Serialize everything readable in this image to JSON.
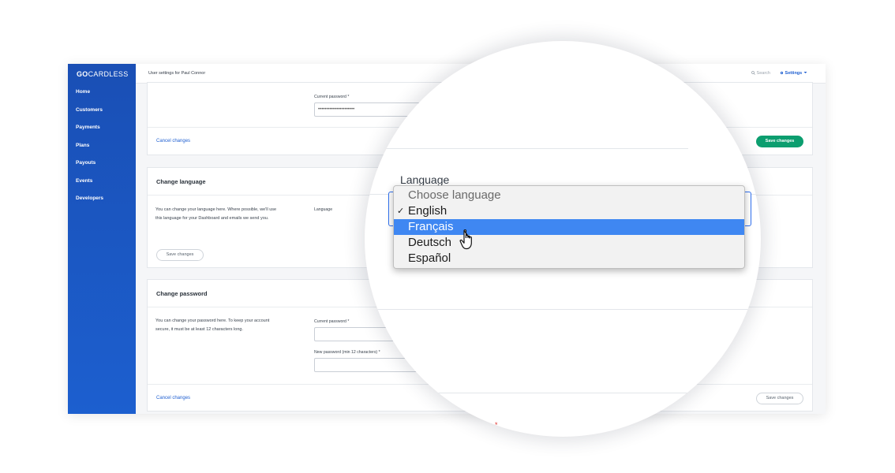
{
  "brand": {
    "bold": "GO",
    "rest": "CARDLESS"
  },
  "nav": [
    "Home",
    "Customers",
    "Payments",
    "Plans",
    "Payouts",
    "Events",
    "Developers"
  ],
  "topbar": {
    "title": "User settings for Paul Connor",
    "search": "Search",
    "settings": "Settings"
  },
  "icons": {
    "search": "search-icon",
    "settings": "gear-icon",
    "caret": "chevron-down-icon",
    "check": "check-icon",
    "cursor": "hand-pointer-icon"
  },
  "colors": {
    "sidebar": "#1c5fcf",
    "accent": "#1f5fd1",
    "save_green": "#0c9e6f",
    "selected_blue": "#3f87f2",
    "required": "#e0332e"
  },
  "top_card": {
    "current_password_label": "Current password *",
    "current_password_value": "••••••••••••••••••••••",
    "cancel": "Cancel changes",
    "save": "Save changes"
  },
  "language_card": {
    "title": "Change language",
    "description": "You can change your language here. Where possible, we'll use this language for your Dashboard and emails we send you.",
    "label": "Language",
    "options": [
      "Choose language",
      "English",
      "Français",
      "Deutsch",
      "Español"
    ],
    "checked": "English",
    "highlighted": "Français",
    "save": "Save changes"
  },
  "password_card": {
    "title": "Change password",
    "description": "You can change your password here. To keep your account secure, it must be at least 12 characters long.",
    "current_label": "Current password *",
    "new_label": "New password (min 12 characters) *",
    "cancel": "Cancel changes",
    "save": "Save changes"
  },
  "lens": {
    "label": "Language",
    "required_mark": "*"
  }
}
